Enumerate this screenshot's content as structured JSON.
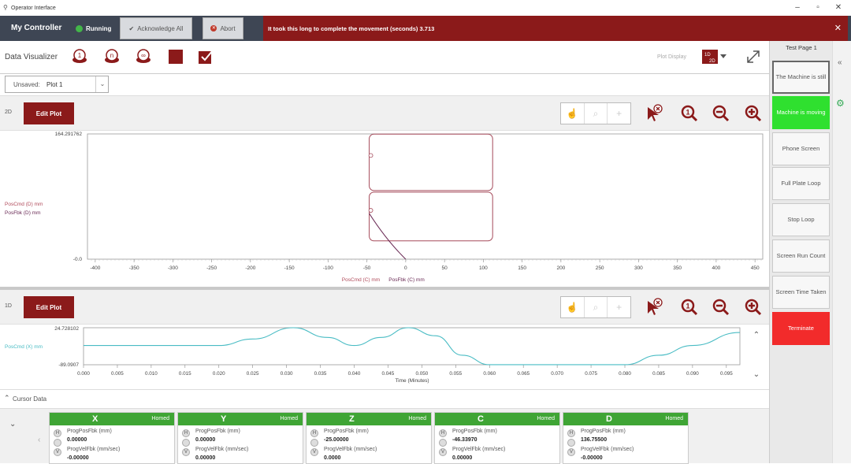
{
  "window": {
    "title": "Operator Interface"
  },
  "topbar": {
    "controller_name": "My Controller",
    "status": "Running",
    "acknowledge_label": "Acknowledge All",
    "abort_label": "Abort",
    "message": "It took this long to complete the movement (seconds) 3.713",
    "colors": {
      "bar": "#3e4654",
      "message_bg": "#8b1a1a",
      "running": "#43b649"
    }
  },
  "toolbar": {
    "title": "Data Visualizer",
    "icons": [
      "run-once-icon",
      "run-n-icon",
      "run-continuous-icon",
      "stop-icon",
      "checklist-icon"
    ],
    "plot_display_label": "Plot Display",
    "plot_mode_icon": "1d-2d-icon",
    "expand_icon": "expand-icon"
  },
  "plot_selector": {
    "prefix": "Unsaved:",
    "value": "Plot 1"
  },
  "pane2d": {
    "type_label": "2D",
    "edit_label": "Edit Plot",
    "ymax_label": "164.291762",
    "ymin_label": "-0.0",
    "legend": [
      "PosCmd (D) mm",
      "PosFbk (D) mm"
    ],
    "xlabel_cmd": "PosCmd (C) mm",
    "xlabel_fbk": "PosFbk (C) mm",
    "xticks": [
      "-400",
      "-350",
      "-300",
      "-250",
      "-200",
      "-150",
      "-100",
      "-50",
      "0",
      "50",
      "100",
      "150",
      "200",
      "250",
      "300",
      "350",
      "400",
      "450"
    ]
  },
  "pane1d": {
    "type_label": "1D",
    "edit_label": "Edit Plot",
    "ymax_label": "24.728102",
    "ymin_label": "-89.0907",
    "legend": [
      "PosCmd (X) mm"
    ],
    "xlabel": "Time (Minutes)",
    "xticks": [
      "0.000",
      "0.005",
      "0.010",
      "0.015",
      "0.020",
      "0.025",
      "0.030",
      "0.035",
      "0.040",
      "0.045",
      "0.050",
      "0.055",
      "0.060",
      "0.065",
      "0.070",
      "0.075",
      "0.080",
      "0.085",
      "0.090",
      "0.095"
    ]
  },
  "chart_data": [
    {
      "type": "line",
      "title": "",
      "xlabel": "PosCmd (C) mm   PosFbk (C) mm",
      "ylabel": "PosCmd (D) mm / PosFbk (D) mm",
      "xlim": [
        -410,
        460
      ],
      "ylim": [
        0,
        164.291762
      ],
      "series": [
        {
          "name": "PosCmd (D) mm",
          "color": "#a54a5a",
          "shape": "two rounded rectangles (x -47 to 112, y 90-164 and y 24-88) traced by the path",
          "x": [
            -47,
            112,
            112,
            -47,
            -47,
            -47,
            112,
            112,
            -47,
            -47,
            -30,
            -10,
            0
          ],
          "y": [
            164,
            164,
            90,
            90,
            164,
            88,
            88,
            24,
            24,
            88,
            30,
            10,
            0
          ]
        }
      ],
      "grid": false
    },
    {
      "type": "line",
      "title": "",
      "xlabel": "Time (Minutes)",
      "ylabel": "",
      "xlim": [
        0,
        0.097
      ],
      "ylim": [
        -89.0907,
        24.728102
      ],
      "series": [
        {
          "name": "PosCmd (X) mm",
          "color": "#49bcc4",
          "x": [
            0,
            0.02,
            0.025,
            0.031,
            0.036,
            0.04,
            0.044,
            0.048,
            0.052,
            0.056,
            0.06,
            0.08,
            0.085,
            0.09,
            0.097
          ],
          "y": [
            -30,
            -30,
            -10,
            24.7,
            -5,
            -30,
            -5,
            24.7,
            0,
            -60,
            -89,
            -89,
            -60,
            -30,
            10
          ]
        }
      ],
      "grid": false
    }
  ],
  "right_panel": {
    "title": "Test Page 1",
    "buttons": [
      {
        "label": "The Machine is still",
        "color": "#f7f7f7"
      },
      {
        "label": "Machine is moving",
        "color": "#2fe02f"
      },
      {
        "label": "Phone Screen",
        "color": "#f7f7f7"
      },
      {
        "label": "Full Plate Loop",
        "color": "#f7f7f7"
      },
      {
        "label": "Stop Loop",
        "color": "#f7f7f7"
      },
      {
        "label": "Screen Run Count",
        "color": "#f7f7f7"
      },
      {
        "label": "Screen Time Taken",
        "color": "#f7f7f7"
      },
      {
        "label": "Terminate",
        "color": "#f22b2b"
      }
    ]
  },
  "cursor": {
    "label": "Cursor Data"
  },
  "axes": [
    {
      "name": "X",
      "status": "Homed",
      "pos_label": "ProgPosFbk (mm)",
      "pos_value": "0.00000",
      "vel_label": "ProgVelFbk (mm/sec)",
      "vel_value": "-0.00000"
    },
    {
      "name": "Y",
      "status": "Homed",
      "pos_label": "ProgPosFbk (mm)",
      "pos_value": "0.00000",
      "vel_label": "ProgVelFbk (mm/sec)",
      "vel_value": "0.00000"
    },
    {
      "name": "Z",
      "status": "Homed",
      "pos_label": "ProgPosFbk (mm)",
      "pos_value": "-25.00000",
      "vel_label": "ProgVelFbk (mm/sec)",
      "vel_value": "0.0000"
    },
    {
      "name": "C",
      "status": "Homed",
      "pos_label": "ProgPosFbk (mm)",
      "pos_value": "-46.33970",
      "vel_label": "ProgVelFbk (mm/sec)",
      "vel_value": "0.00000"
    },
    {
      "name": "D",
      "status": "Homed",
      "pos_label": "ProgPosFbk (mm)",
      "pos_value": "136.75500",
      "vel_label": "ProgVelFbk (mm/sec)",
      "vel_value": "-0.00000"
    }
  ],
  "axis_letters": {
    "h": "H",
    "v": "V"
  }
}
